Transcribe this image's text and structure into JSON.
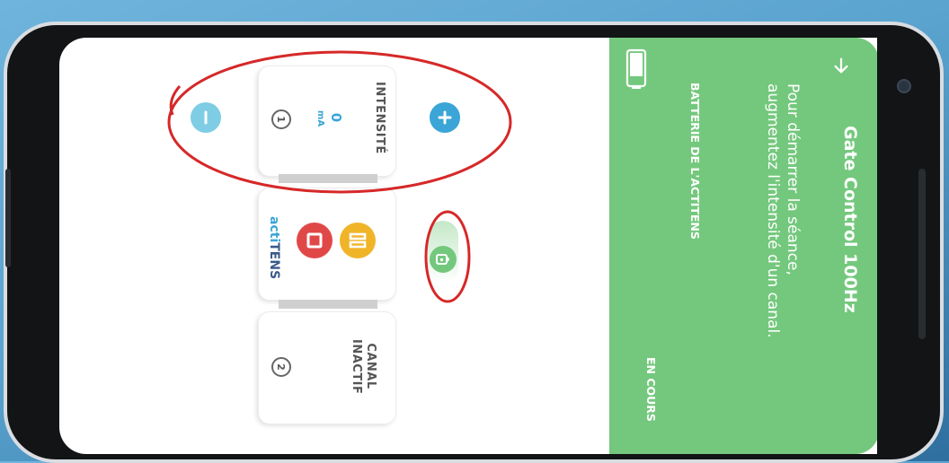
{
  "panel": {
    "title": "Gate Control 100Hz",
    "message": "Pour démarrer la séance, augmentez l'intensité d'un canal.",
    "battery_label": "BATTERIE DE L'ACTITENS",
    "status": "EN COURS",
    "color": "#74c87d"
  },
  "channel1": {
    "number": "1",
    "label": "INTENSITÉ",
    "value": "0",
    "unit": "mA",
    "plus_icon": "plus-icon",
    "minus_icon": "minus-icon"
  },
  "device": {
    "brand_prefix": "acti",
    "brand_suffix": "TENS",
    "stop_icon": "stop-icon",
    "pause_icon": "pause-icon",
    "lock_icon": "lock-icon"
  },
  "channel2": {
    "number": "2",
    "label_line1": "CANAL",
    "label_line2": "INACTIF"
  },
  "colors": {
    "accent_blue": "#3aa5d6",
    "stop_red": "#e04848",
    "pause_yellow": "#f0b429",
    "annotation_red": "#d62828"
  }
}
